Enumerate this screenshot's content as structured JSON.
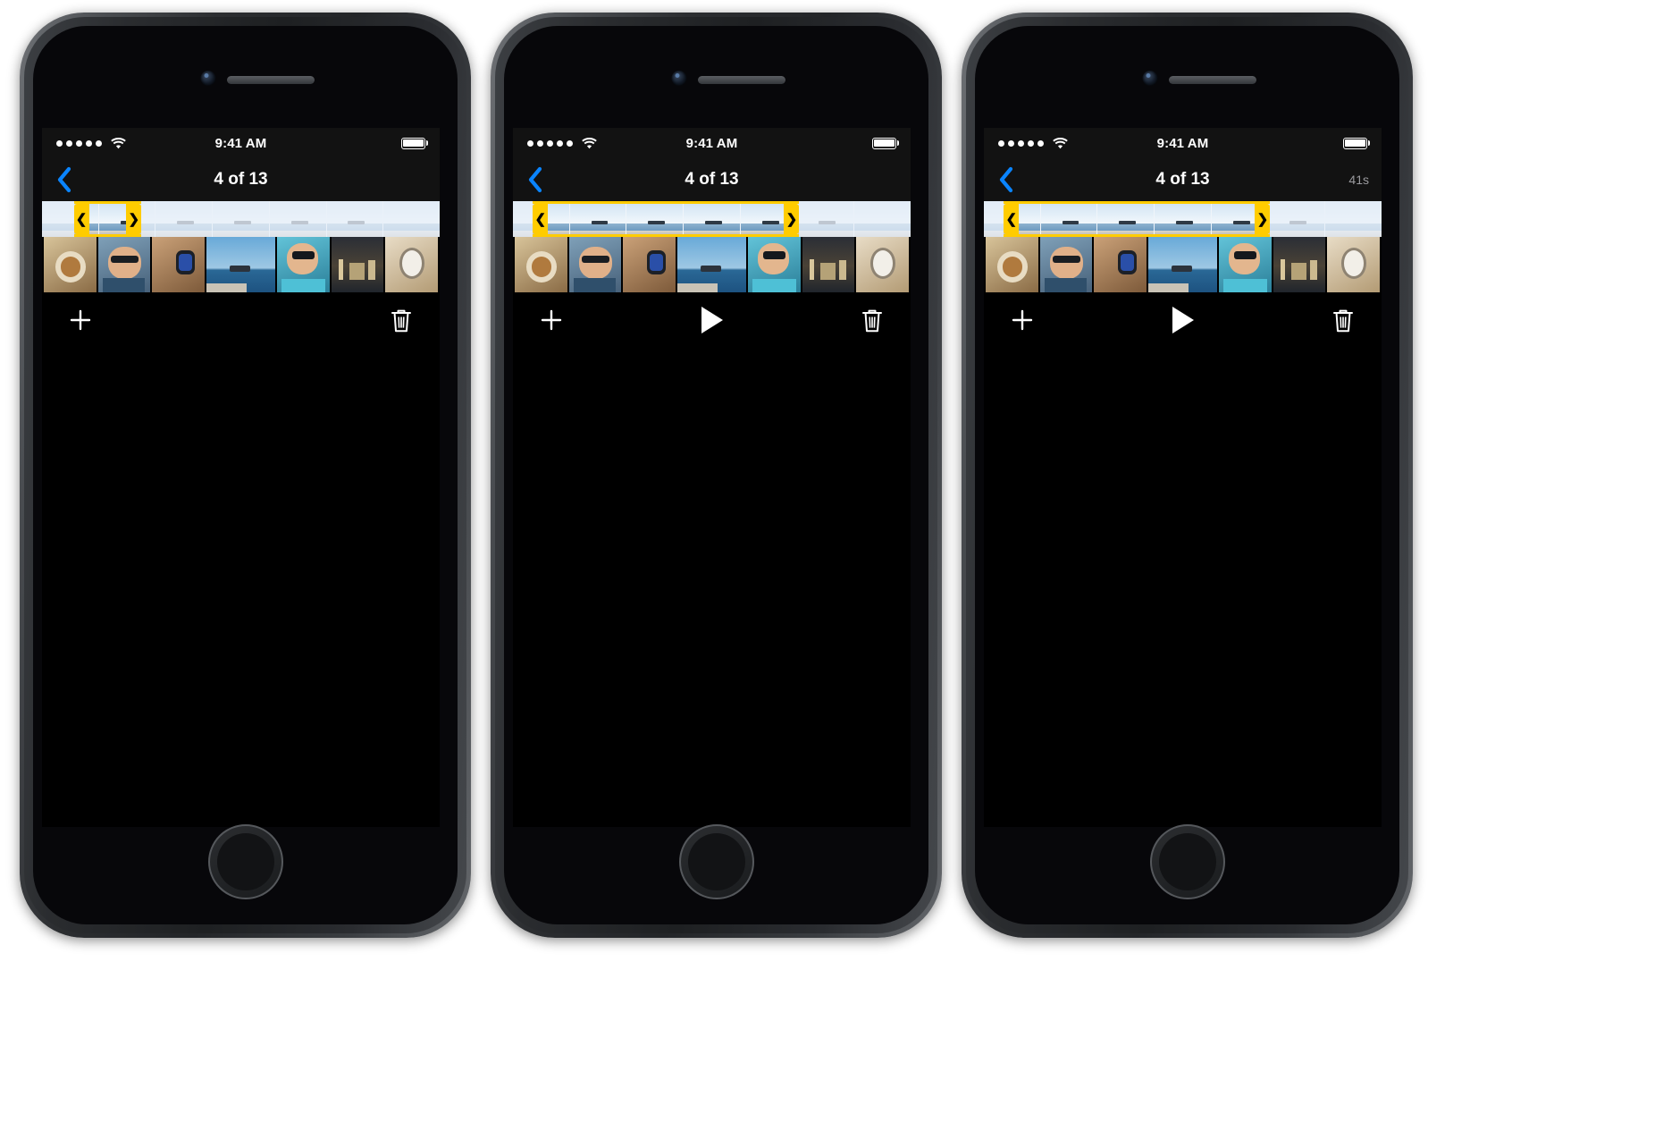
{
  "app": {
    "name": "iOS Photos Video Trim",
    "accent_blue": "#0a84ff",
    "trim_yellow": "#ffcc00"
  },
  "status_bar": {
    "signal_dots": 5,
    "wifi_icon": "wifi-icon",
    "time": "9:41 AM",
    "battery_icon": "battery-icon"
  },
  "nav": {
    "back_icon": "back-chevron-icon",
    "title": "4 of 13",
    "duration_label": "41s",
    "duration_label_empty": ""
  },
  "scrubber": {
    "handle_left_glyph": "❮",
    "handle_right_glyph": "❯",
    "frame_count": 7,
    "phones": [
      {
        "sel_start_pct": 8,
        "sel_end_pct": 25
      },
      {
        "sel_start_pct": 5,
        "sel_end_pct": 72
      },
      {
        "sel_start_pct": 5,
        "sel_end_pct": 72
      }
    ]
  },
  "video": {
    "play_button": "play-button",
    "mute_muted_icon": "speaker-muted-icon",
    "mute_unmuted_icon": "speaker-on-icon"
  },
  "toolbar": {
    "add_label": "+",
    "add_icon": "plus-icon",
    "play_icon": "play-icon",
    "trash_icon": "trash-icon"
  },
  "filmstrip": {
    "thumbs": [
      {
        "name": "food-bowl-photo"
      },
      {
        "name": "person-sunglasses-photo"
      },
      {
        "name": "hand-watch-photo"
      },
      {
        "name": "seascape-video-photo"
      },
      {
        "name": "person-drinking-photo"
      },
      {
        "name": "town-skyline-photo"
      },
      {
        "name": "watch-closeup-photo"
      }
    ]
  },
  "phones": [
    {
      "id": "phone-1",
      "show_play_overlay": true,
      "muted": true,
      "show_toolbar_play": false,
      "show_duration": false
    },
    {
      "id": "phone-2",
      "show_play_overlay": false,
      "muted": false,
      "show_toolbar_play": true,
      "show_duration": false
    },
    {
      "id": "phone-3",
      "show_play_overlay": false,
      "muted": true,
      "show_toolbar_play": true,
      "show_duration": true
    }
  ]
}
